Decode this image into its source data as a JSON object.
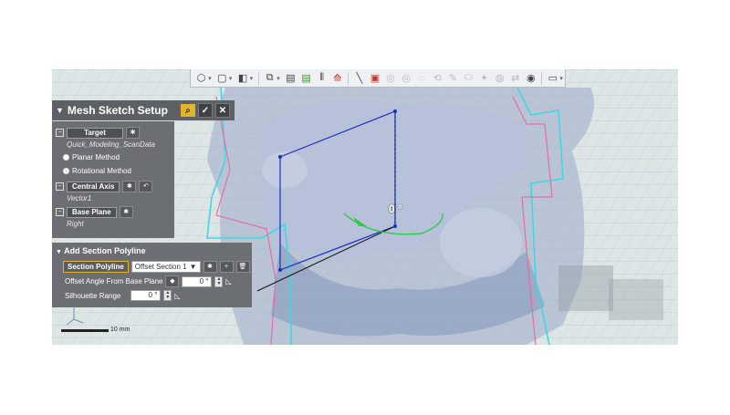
{
  "panel": {
    "title": "Mesh Sketch Setup",
    "target_label": "Target",
    "target_value": "Quick_Modeling_ScanData",
    "method_planar": "Planar Method",
    "method_rotational": "Rotational Method",
    "central_axis_label": "Central Axis",
    "central_axis_value": "Vector1",
    "base_plane_label": "Base Plane",
    "base_plane_value": "Right"
  },
  "polyline": {
    "title": "Add Section Polyline",
    "section_button": "Section Polyline",
    "offset_dropdown": "Offset Section 1",
    "offset_angle_label": "Offset Angle From Base Plane",
    "offset_angle_value": "0 °",
    "silhouette_label": "Silhouette Range",
    "silhouette_value": "0 °"
  },
  "viewport": {
    "angle_label": "0 °",
    "scale_label": "10 mm"
  },
  "colors": {
    "panel_bg": "#6b6e72",
    "title_bg": "#5d6064",
    "accent_yellow": "#e5b333",
    "section_cyan": "#3fd6e6",
    "section_pink": "#e86aa8",
    "sketch_blue": "#1a2fbf"
  },
  "icons": [
    "view-cube-icon",
    "box-icon",
    "shading-icon",
    "section-icon",
    "doc-icon",
    "doc-green-icon",
    "split-icon",
    "measure-icon",
    "select-rect-icon",
    "eye-icon"
  ]
}
